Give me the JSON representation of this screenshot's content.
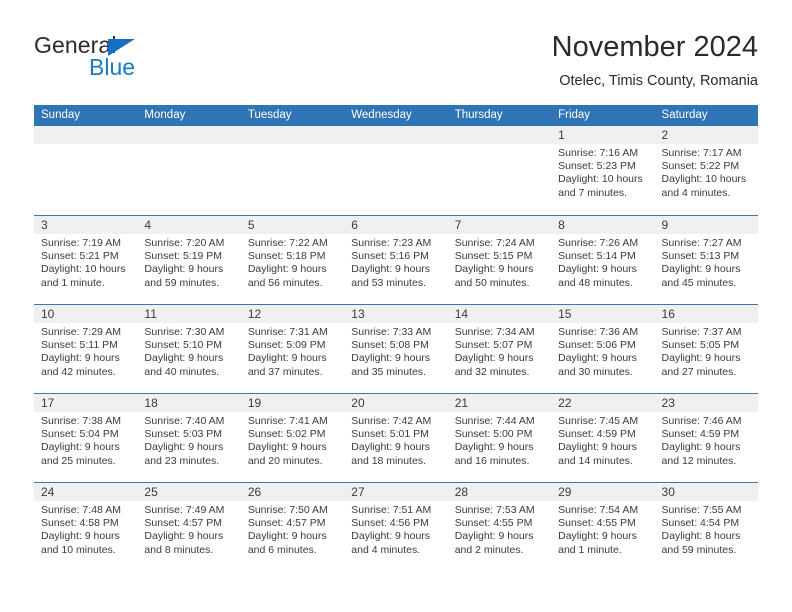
{
  "brand": {
    "name_top": "General",
    "name_bottom": "Blue",
    "flag_icon": "triangle-flag-icon",
    "accent_color": "#1a7ac4"
  },
  "header": {
    "month_title": "November 2024",
    "location": "Otelec, Timis County, Romania"
  },
  "calendar": {
    "header_bg": "#2f74b5",
    "date_band_bg": "#f0f0f0",
    "weekdays": [
      "Sunday",
      "Monday",
      "Tuesday",
      "Wednesday",
      "Thursday",
      "Friday",
      "Saturday"
    ],
    "weeks": [
      [
        {
          "date": "",
          "empty": true,
          "lines": []
        },
        {
          "date": "",
          "empty": true,
          "lines": []
        },
        {
          "date": "",
          "empty": true,
          "lines": []
        },
        {
          "date": "",
          "empty": true,
          "lines": []
        },
        {
          "date": "",
          "empty": true,
          "lines": []
        },
        {
          "date": "1",
          "empty": false,
          "lines": [
            "Sunrise: 7:16 AM",
            "Sunset: 5:23 PM",
            "Daylight: 10 hours",
            "and 7 minutes."
          ]
        },
        {
          "date": "2",
          "empty": false,
          "lines": [
            "Sunrise: 7:17 AM",
            "Sunset: 5:22 PM",
            "Daylight: 10 hours",
            "and 4 minutes."
          ]
        }
      ],
      [
        {
          "date": "3",
          "empty": false,
          "lines": [
            "Sunrise: 7:19 AM",
            "Sunset: 5:21 PM",
            "Daylight: 10 hours",
            "and 1 minute."
          ]
        },
        {
          "date": "4",
          "empty": false,
          "lines": [
            "Sunrise: 7:20 AM",
            "Sunset: 5:19 PM",
            "Daylight: 9 hours",
            "and 59 minutes."
          ]
        },
        {
          "date": "5",
          "empty": false,
          "lines": [
            "Sunrise: 7:22 AM",
            "Sunset: 5:18 PM",
            "Daylight: 9 hours",
            "and 56 minutes."
          ]
        },
        {
          "date": "6",
          "empty": false,
          "lines": [
            "Sunrise: 7:23 AM",
            "Sunset: 5:16 PM",
            "Daylight: 9 hours",
            "and 53 minutes."
          ]
        },
        {
          "date": "7",
          "empty": false,
          "lines": [
            "Sunrise: 7:24 AM",
            "Sunset: 5:15 PM",
            "Daylight: 9 hours",
            "and 50 minutes."
          ]
        },
        {
          "date": "8",
          "empty": false,
          "lines": [
            "Sunrise: 7:26 AM",
            "Sunset: 5:14 PM",
            "Daylight: 9 hours",
            "and 48 minutes."
          ]
        },
        {
          "date": "9",
          "empty": false,
          "lines": [
            "Sunrise: 7:27 AM",
            "Sunset: 5:13 PM",
            "Daylight: 9 hours",
            "and 45 minutes."
          ]
        }
      ],
      [
        {
          "date": "10",
          "empty": false,
          "lines": [
            "Sunrise: 7:29 AM",
            "Sunset: 5:11 PM",
            "Daylight: 9 hours",
            "and 42 minutes."
          ]
        },
        {
          "date": "11",
          "empty": false,
          "lines": [
            "Sunrise: 7:30 AM",
            "Sunset: 5:10 PM",
            "Daylight: 9 hours",
            "and 40 minutes."
          ]
        },
        {
          "date": "12",
          "empty": false,
          "lines": [
            "Sunrise: 7:31 AM",
            "Sunset: 5:09 PM",
            "Daylight: 9 hours",
            "and 37 minutes."
          ]
        },
        {
          "date": "13",
          "empty": false,
          "lines": [
            "Sunrise: 7:33 AM",
            "Sunset: 5:08 PM",
            "Daylight: 9 hours",
            "and 35 minutes."
          ]
        },
        {
          "date": "14",
          "empty": false,
          "lines": [
            "Sunrise: 7:34 AM",
            "Sunset: 5:07 PM",
            "Daylight: 9 hours",
            "and 32 minutes."
          ]
        },
        {
          "date": "15",
          "empty": false,
          "lines": [
            "Sunrise: 7:36 AM",
            "Sunset: 5:06 PM",
            "Daylight: 9 hours",
            "and 30 minutes."
          ]
        },
        {
          "date": "16",
          "empty": false,
          "lines": [
            "Sunrise: 7:37 AM",
            "Sunset: 5:05 PM",
            "Daylight: 9 hours",
            "and 27 minutes."
          ]
        }
      ],
      [
        {
          "date": "17",
          "empty": false,
          "lines": [
            "Sunrise: 7:38 AM",
            "Sunset: 5:04 PM",
            "Daylight: 9 hours",
            "and 25 minutes."
          ]
        },
        {
          "date": "18",
          "empty": false,
          "lines": [
            "Sunrise: 7:40 AM",
            "Sunset: 5:03 PM",
            "Daylight: 9 hours",
            "and 23 minutes."
          ]
        },
        {
          "date": "19",
          "empty": false,
          "lines": [
            "Sunrise: 7:41 AM",
            "Sunset: 5:02 PM",
            "Daylight: 9 hours",
            "and 20 minutes."
          ]
        },
        {
          "date": "20",
          "empty": false,
          "lines": [
            "Sunrise: 7:42 AM",
            "Sunset: 5:01 PM",
            "Daylight: 9 hours",
            "and 18 minutes."
          ]
        },
        {
          "date": "21",
          "empty": false,
          "lines": [
            "Sunrise: 7:44 AM",
            "Sunset: 5:00 PM",
            "Daylight: 9 hours",
            "and 16 minutes."
          ]
        },
        {
          "date": "22",
          "empty": false,
          "lines": [
            "Sunrise: 7:45 AM",
            "Sunset: 4:59 PM",
            "Daylight: 9 hours",
            "and 14 minutes."
          ]
        },
        {
          "date": "23",
          "empty": false,
          "lines": [
            "Sunrise: 7:46 AM",
            "Sunset: 4:59 PM",
            "Daylight: 9 hours",
            "and 12 minutes."
          ]
        }
      ],
      [
        {
          "date": "24",
          "empty": false,
          "lines": [
            "Sunrise: 7:48 AM",
            "Sunset: 4:58 PM",
            "Daylight: 9 hours",
            "and 10 minutes."
          ]
        },
        {
          "date": "25",
          "empty": false,
          "lines": [
            "Sunrise: 7:49 AM",
            "Sunset: 4:57 PM",
            "Daylight: 9 hours",
            "and 8 minutes."
          ]
        },
        {
          "date": "26",
          "empty": false,
          "lines": [
            "Sunrise: 7:50 AM",
            "Sunset: 4:57 PM",
            "Daylight: 9 hours",
            "and 6 minutes."
          ]
        },
        {
          "date": "27",
          "empty": false,
          "lines": [
            "Sunrise: 7:51 AM",
            "Sunset: 4:56 PM",
            "Daylight: 9 hours",
            "and 4 minutes."
          ]
        },
        {
          "date": "28",
          "empty": false,
          "lines": [
            "Sunrise: 7:53 AM",
            "Sunset: 4:55 PM",
            "Daylight: 9 hours",
            "and 2 minutes."
          ]
        },
        {
          "date": "29",
          "empty": false,
          "lines": [
            "Sunrise: 7:54 AM",
            "Sunset: 4:55 PM",
            "Daylight: 9 hours",
            "and 1 minute."
          ]
        },
        {
          "date": "30",
          "empty": false,
          "lines": [
            "Sunrise: 7:55 AM",
            "Sunset: 4:54 PM",
            "Daylight: 8 hours",
            "and 59 minutes."
          ]
        }
      ]
    ]
  }
}
